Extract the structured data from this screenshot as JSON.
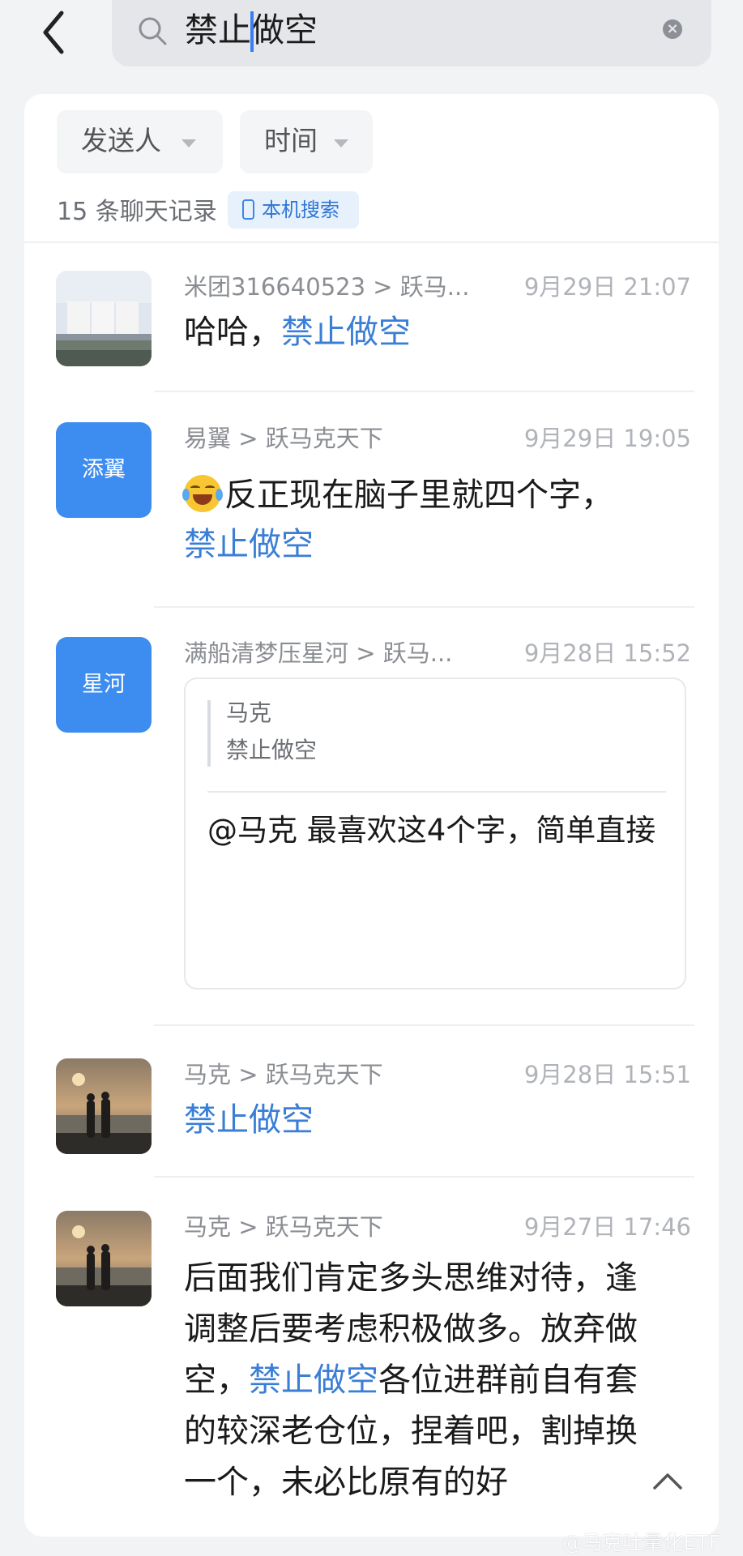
{
  "search": {
    "query_before": "禁止",
    "query_after": "做空"
  },
  "filters": {
    "sender": "发送人",
    "time": "时间"
  },
  "summary": {
    "count": "15 条聊天记录",
    "local_search": "本机搜索"
  },
  "results": [
    {
      "source": "米团316640523 > 跃马...",
      "time": "9月29日 21:07",
      "text_before": "哈哈，",
      "highlight": "禁止做空"
    },
    {
      "avatar_text": "添翼",
      "source": "易翼 > 跃马克天下",
      "time": "9月29日 19:05",
      "text_before": "反正现在脑子里就四个字，",
      "highlight": "禁止做空",
      "emoji": "tears-of-joy"
    },
    {
      "avatar_text": "星河",
      "source": "满船清梦压星河 > 跃马...",
      "time": "9月28日 15:52",
      "quote_name": "马克",
      "quote_text": "禁止做空",
      "reply": "@马克 最喜欢这4个字，简单直接"
    },
    {
      "source": "马克 > 跃马克天下",
      "time": "9月28日 15:51",
      "highlight": "禁止做空"
    },
    {
      "source": "马克 > 跃马克天下",
      "time": "9月27日 17:46",
      "text_before": "后面我们肯定多头思维对待，逢调整后要考虑积极做多。放弃做空，",
      "highlight": "禁止做空",
      "text_after": "各位进群前自有套的较深老仓位，捏着吧，割掉换一个，未必比原有的好"
    }
  ],
  "watermark": "@马克吐量化ETF",
  "colors": {
    "accent": "#3a7ed6",
    "avatar_blue": "#3d8cf0",
    "background": "#f2f3f5"
  }
}
